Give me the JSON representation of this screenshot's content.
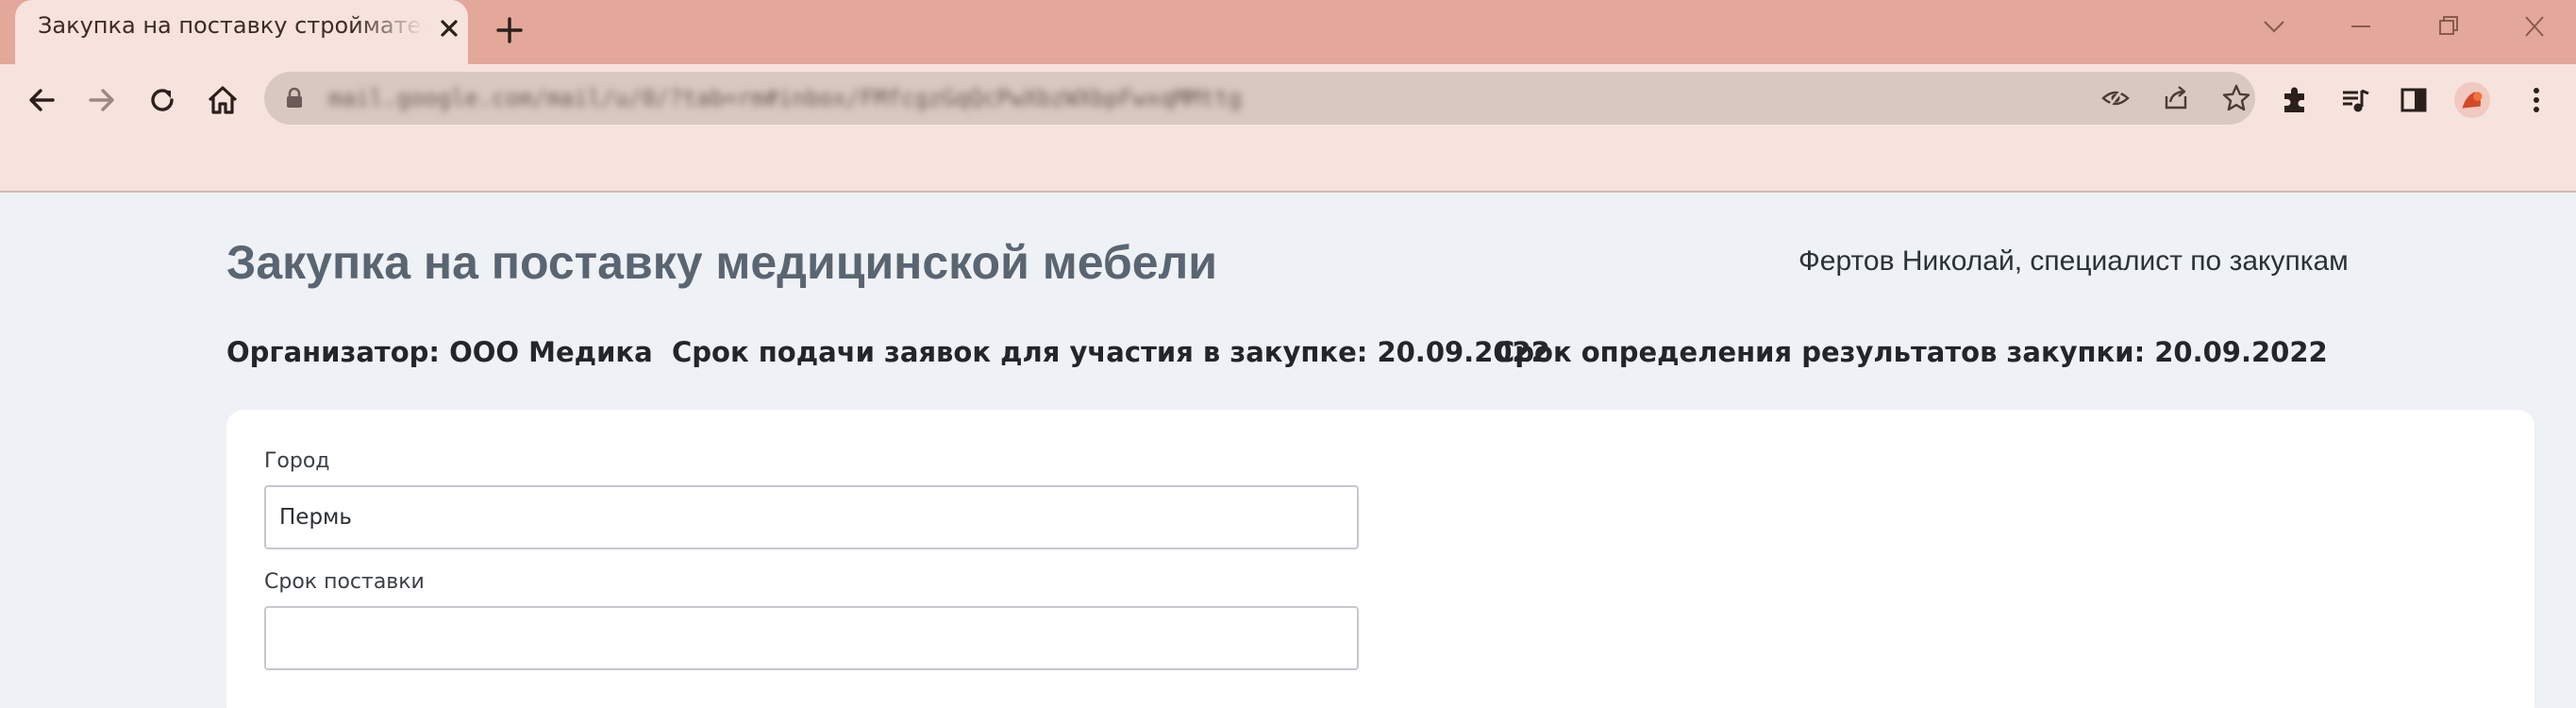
{
  "browser": {
    "tab_title": "Закупка на поставку стройматериалов",
    "url": "mail.google.com/mail/u/0/?tab=rm#inbox/FMfcgzGqQcPwXbzWXbpFwxqMMttg",
    "colors": {
      "titlebar": "#e3a899",
      "toolbar": "#f6e3de"
    },
    "icons": [
      "close-icon",
      "plus-icon",
      "back-icon",
      "forward-icon",
      "reload-icon",
      "home-icon",
      "lock-icon",
      "eye-icon",
      "share-icon",
      "star-icon",
      "extensions-icon",
      "media-icon",
      "sidepanel-icon",
      "profile-avatar",
      "menu-icon",
      "chevron-down-icon",
      "minimize-icon",
      "restore-icon"
    ]
  },
  "page": {
    "title": "Закупка на поставку медицинской мебели",
    "user": "Фертов Николай, специалист по закупкам",
    "organizer": "Организатор: ООО Медика",
    "deadline": "Срок подачи заявок для участия в закупке: 20.09.2022",
    "results_date": "Срок определения результатов закупки: 20.09.2022"
  },
  "form": {
    "city_label": "Город",
    "city_value": "Пермь",
    "delivery_label": "Срок поставки",
    "delivery_value": ""
  }
}
